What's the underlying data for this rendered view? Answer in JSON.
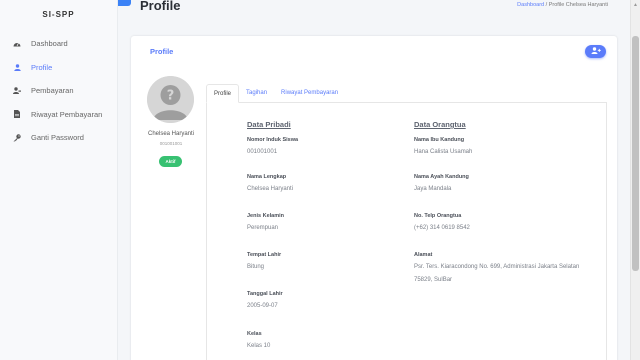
{
  "app": {
    "brand": "SI-SPP"
  },
  "sidebar": {
    "items": [
      {
        "label": "Dashboard",
        "icon": "dashboard-icon"
      },
      {
        "label": "Profile",
        "icon": "user-icon"
      },
      {
        "label": "Pembayaran",
        "icon": "user-payment-icon"
      },
      {
        "label": "Riwayat Pembayaran",
        "icon": "document-icon"
      },
      {
        "label": "Ganti Password",
        "icon": "key-icon"
      }
    ]
  },
  "header": {
    "title": "Profile",
    "breadcrumb": {
      "parent": "Dashboard",
      "separator": "/",
      "current": "Profile Chelsea Haryanti"
    }
  },
  "card": {
    "title": "Profile",
    "add_button_icon": "user-plus-icon"
  },
  "student": {
    "name": "Chelsea Haryanti",
    "nis": "001001001",
    "status": "Aktif"
  },
  "tabs": [
    {
      "label": "Profile",
      "active": true
    },
    {
      "label": "Tagihan",
      "active": false
    },
    {
      "label": "Riwayat Pembayaran",
      "active": false
    }
  ],
  "personal": {
    "title": "Data Pribadi",
    "fields": [
      {
        "label": "Nomor Induk Siswa",
        "value": "001001001"
      },
      {
        "label": "Nama Lengkap",
        "value": "Chelsea Haryanti"
      },
      {
        "label": "Jenis Kelamin",
        "value": "Perempuan"
      },
      {
        "label": "Tempat Lahir",
        "value": "Bitung"
      },
      {
        "label": "Tanggal Lahir",
        "value": "2005-09-07"
      },
      {
        "label": "Kelas",
        "value": "Kelas 10"
      }
    ]
  },
  "parents": {
    "title": "Data Orangtua",
    "fields": [
      {
        "label": "Nama Ibu Kandung",
        "value": "Hana Calista Usamah"
      },
      {
        "label": "Nama Ayah Kandung",
        "value": "Jaya Mandala"
      },
      {
        "label": "No. Telp Orangtua",
        "value": "(+62) 314 0619 8542"
      },
      {
        "label": "Alamat",
        "value": "Psr. Ters. Kiaracondong No. 699, Administrasi Jakarta Selatan 75829, SulBar"
      }
    ]
  },
  "colors": {
    "accent": "#5b7cfa",
    "success": "#38c172",
    "top_accent": "#3b82f6"
  }
}
